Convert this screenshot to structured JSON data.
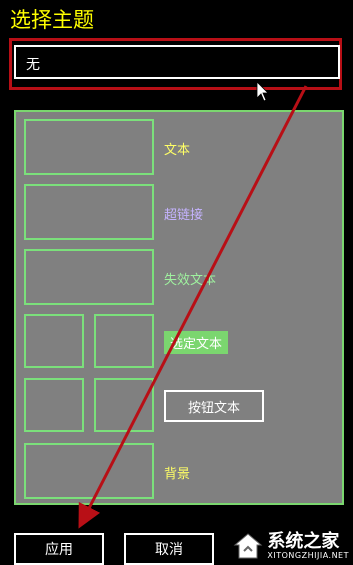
{
  "title": "选择主题",
  "combo": {
    "value": "无"
  },
  "preview": {
    "text_label": "文本",
    "link_label": "超链接",
    "disabled_label": "失效文本",
    "selected_label": "选定文本",
    "button_text_label": "按钮文本",
    "background_label": "背景"
  },
  "buttons": {
    "apply": "应用",
    "cancel": "取消"
  },
  "watermark": {
    "main": "系统之家",
    "sub": "XITONGZHIJIA.NET"
  },
  "colors": {
    "annotation": "#b80f16",
    "title": "#ffff00",
    "frame": "#7bd66f"
  }
}
